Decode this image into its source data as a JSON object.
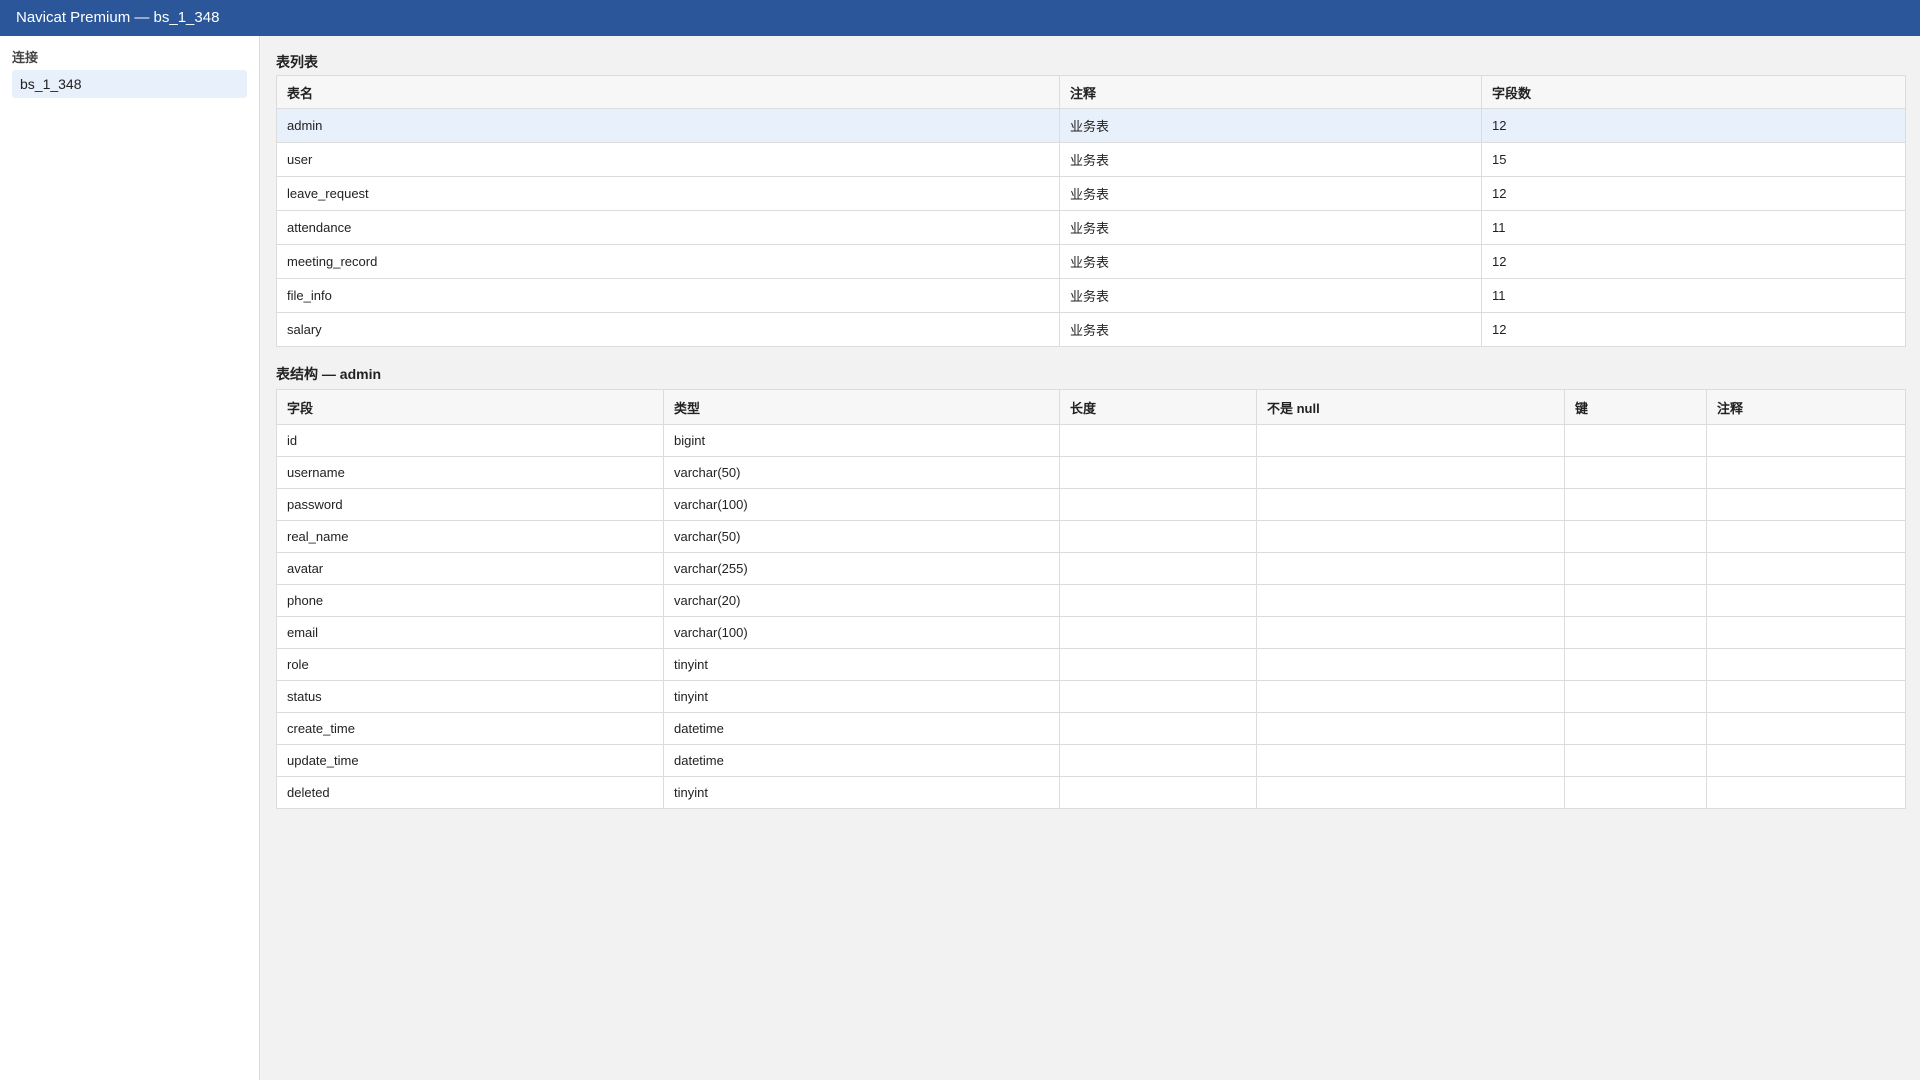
{
  "window": {
    "title": "Navicat Premium — bs_1_348"
  },
  "sidebar": {
    "heading": "连接",
    "connections": [
      {
        "label": "bs_1_348",
        "selected": true
      }
    ]
  },
  "table_list": {
    "title": "表列表",
    "headers": [
      "表名",
      "注释",
      "字段数"
    ],
    "rows": [
      [
        "admin",
        "业务表",
        "12"
      ],
      [
        "user",
        "业务表",
        "15"
      ],
      [
        "leave_request",
        "业务表",
        "12"
      ],
      [
        "attendance",
        "业务表",
        "11"
      ],
      [
        "meeting_record",
        "业务表",
        "12"
      ],
      [
        "file_info",
        "业务表",
        "11"
      ],
      [
        "salary",
        "业务表",
        "12"
      ]
    ],
    "selected_index": 0
  },
  "structure": {
    "title": "表结构 — admin",
    "headers": [
      "字段",
      "类型",
      "长度",
      "不是 null",
      "键",
      "注释"
    ],
    "rows": [
      [
        "id",
        "bigint",
        "",
        "",
        "",
        ""
      ],
      [
        "username",
        "varchar(50)",
        "",
        "",
        "",
        ""
      ],
      [
        "password",
        "varchar(100)",
        "",
        "",
        "",
        ""
      ],
      [
        "real_name",
        "varchar(50)",
        "",
        "",
        "",
        ""
      ],
      [
        "avatar",
        "varchar(255)",
        "",
        "",
        "",
        ""
      ],
      [
        "phone",
        "varchar(20)",
        "",
        "",
        "",
        ""
      ],
      [
        "email",
        "varchar(100)",
        "",
        "",
        "",
        ""
      ],
      [
        "role",
        "tinyint",
        "",
        "",
        "",
        ""
      ],
      [
        "status",
        "tinyint",
        "",
        "",
        "",
        ""
      ],
      [
        "create_time",
        "datetime",
        "",
        "",
        "",
        ""
      ],
      [
        "update_time",
        "datetime",
        "",
        "",
        "",
        ""
      ],
      [
        "deleted",
        "tinyint",
        "",
        "",
        "",
        ""
      ]
    ]
  },
  "colors": {
    "titlebar": "#2b579a",
    "selected_row": "#e8f0fb",
    "border": "#dcdcdc"
  }
}
